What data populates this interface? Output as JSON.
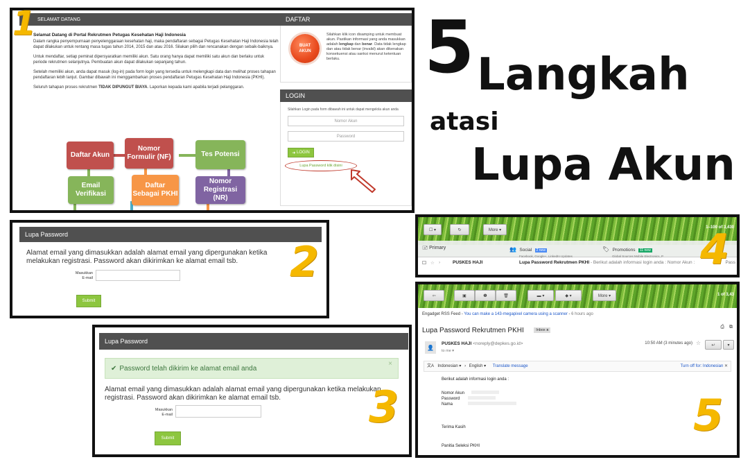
{
  "headline": {
    "number": "5",
    "word1": "Langkah",
    "word2": "atasi",
    "word3": "Lupa Akun"
  },
  "step_numbers": [
    "1",
    "2",
    "3",
    "4",
    "5"
  ],
  "panel1": {
    "header": "SELAMAT DATANG",
    "heading": "Selamat Datang di Portal Rekrutmen Petugas Kesehatan Haji Indonesia",
    "para1": "Dalam rangka penyempurnaan penyelenggaraan kesehatan haji, maka pendaftaran sebagai Petugas Kesehatan Haji Indonesia telah dapat dilakukan untuk rentang masa tugas tahun 2014, 2015 dan atau 2016. Silakan pilih dan rencanakan dengan sebaik-baiknya.",
    "para2": "Untuk mendaftar, setiap peminat dipersyaratkan memiliki akun. Satu orang hanya dapat memiliki satu akun dan berlaku untuk periode rekrutmen selanjutnya. Pembuatan akun dapat dilakukan sepanjang tahun.",
    "para3": "Setelah memiliki akun, anda dapat masuk (log-in) pada form login yang tersedia untuk melengkapi data dan melihat proses tahapan pendaftaran lebih lanjut. Gambar dibawah ini menggambarkan proses pendaftaran Petugas Kesehatan Haji Indonesia (PKHI).",
    "para4_a": "Seluruh tahapan proses rekrutmen ",
    "para4_b": "TIDAK DIPUNGUT BIAYA",
    "para4_c": ". Laporkan kepada kami apabila terjadi pelanggaran.",
    "flow": {
      "daftar_akun": "Daftar Akun",
      "nomor_formulir": "Nomor Formulir (NF)",
      "tes_potensi": "Tes Potensi",
      "email_verifikasi": "Email Verifikasi",
      "daftar_pkhi": "Daftar Sebagai PKHI",
      "nomor_registrasi": "Nomor Registrasi (NR)"
    },
    "colors": {
      "red": "#c0504d",
      "green": "#86b55a",
      "orange": "#f79646",
      "purple": "#8064a2",
      "teal": "#4bacc6"
    },
    "daftar": {
      "header": "DAFTAR",
      "button": "BUAT AKUN",
      "text_a": "Silahkan klik icon disamping untuk membuat akun. Pastikan informasi yang anda masukkan adalah ",
      "text_b": "lengkap",
      "text_c": " dan ",
      "text_d": "benar",
      "text_e": ". Data tidak lengkap dan atau tidak benar (invalid) akan dikenakan konsekuensi atau sanksi menurut ketentuan berlaku."
    },
    "login": {
      "header": "LOGIN",
      "instruction": "Silahkan Login pada form dibawah ini untuk dapat mengelola akun anda",
      "account_placeholder": "Nomor Akun",
      "password_placeholder": "Password",
      "button": "LOGIN",
      "forgot_link": "Lupa Password klik disini"
    }
  },
  "panel2": {
    "header": "Lupa Password",
    "message": "Alamat email yang dimasukkan adalah alamat email yang dipergunakan ketika melakukan registrasi. Password akan dikirimkan ke alamat email tsb.",
    "email_label": "Masukkan E-mail",
    "submit": "Submit"
  },
  "panel3": {
    "header": "Lupa Password",
    "alert": "Password telah dikirim ke alamat email anda",
    "close": "×",
    "message": "Alamat email yang dimasukkan adalah alamat email yang dipergunakan ketika melakukan registrasi. Password akan dikirimkan ke alamat email tsb.",
    "email_label": "Masukkan E-mail",
    "submit": "Submit"
  },
  "panel4": {
    "more": "More ▾",
    "range": "1–100 of 3,430",
    "tabs": {
      "primary": "Primary",
      "social": "Social",
      "social_badge": "2 new",
      "social_sub": "Facebook, Google+, LinkedIn Updates",
      "promotions": "Promotions",
      "promotions_badge": "11 new",
      "promotions_sub": "Global Sources Mobile Electronics, P"
    },
    "row": {
      "sender": "PUSKES HAJI",
      "subject": "Lupa Password Rekrutmen PKHI",
      "snippet": " - Berikut adalah informasi login anda : Nomor Akun :",
      "tail": "Pass"
    }
  },
  "panel5": {
    "more": "More ▾",
    "range": "1 of 3,43",
    "rss_label": "Engadget RSS Feed",
    "rss_text": "You can make a 143-megapixel camera using a scanner",
    "rss_time": "6 hours ago",
    "subject": "Lupa Password Rekrutmen PKHI",
    "label": "Inbox",
    "label_x": "x",
    "sender_name": "PUSKES HAJI",
    "sender_email": "<noreply@depkes.go.id>",
    "to": "to me",
    "time": "10:50 AM (3 minutes ago)",
    "lang_from": "Indonesian ▾",
    "arrow": "›",
    "lang_to": "English ▾",
    "translate": "Translate message",
    "turn_off": "Turn off for: Indonesian",
    "body_intro": "Berikut adalah informasi login anda :",
    "f_account": "Nomor Akun",
    "f_password": "Password",
    "f_name": "Nama",
    "thanks": "Terima Kasih",
    "signature": "Panitia Seleksi PKHI"
  }
}
